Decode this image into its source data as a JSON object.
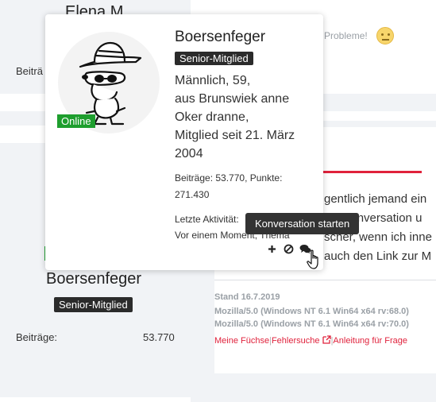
{
  "background": {
    "left_top_name": "Elena M",
    "left_top_stats_label": "Beiträ",
    "left_user": {
      "name": "Boersenfeger",
      "title": "Senior-Mitglied",
      "posts_label": "Beiträge:",
      "posts_value": "53.770"
    },
    "right": {
      "probleme_text": "n Probleme!",
      "text_lines": [
        "gentlich jemand ein",
        "via Konversation u",
        "scher, wenn ich inne",
        "auch den Link zur M"
      ],
      "stand": "Stand 16.7.2019",
      "ua_lines": [
        "Mozilla/5.0 (Windows NT 6.1 Win64 x64 rv:68.0)",
        "Mozilla/5.0 (Windows NT 6.1 Win64 x64 rv:70.0)"
      ],
      "links": [
        "Meine Füchse",
        "Fehlersuche",
        "Anleitung für Frage"
      ],
      "link_separator": "|"
    }
  },
  "card": {
    "online_label": "Online",
    "name": "Boersenfeger",
    "title": "Senior-Mitglied",
    "info_lines": [
      "Männlich, 59,",
      "aus Brunswiek anne",
      "Oker dranne,",
      "Mitglied seit 21. März",
      "2004"
    ],
    "stats_line1": "Beiträge: 53.770, Punkte:",
    "stats_line2": "271.430",
    "activity_line1": "Letzte Aktivität:",
    "activity_line2": "Vor einem Moment, Thema",
    "actions": [
      {
        "icon": "plus-icon",
        "label": "Folgen"
      },
      {
        "icon": "block-icon",
        "label": "Ignorieren"
      },
      {
        "icon": "chat-bubbles-icon",
        "label": "Konversation starten"
      }
    ],
    "tooltip": "Konversation starten"
  },
  "colors": {
    "online_green": "#1e9e2e",
    "badge_dark": "#2b2b2b",
    "accent_red": "#e0223c",
    "sidebar_bg": "#f1f3f6"
  }
}
